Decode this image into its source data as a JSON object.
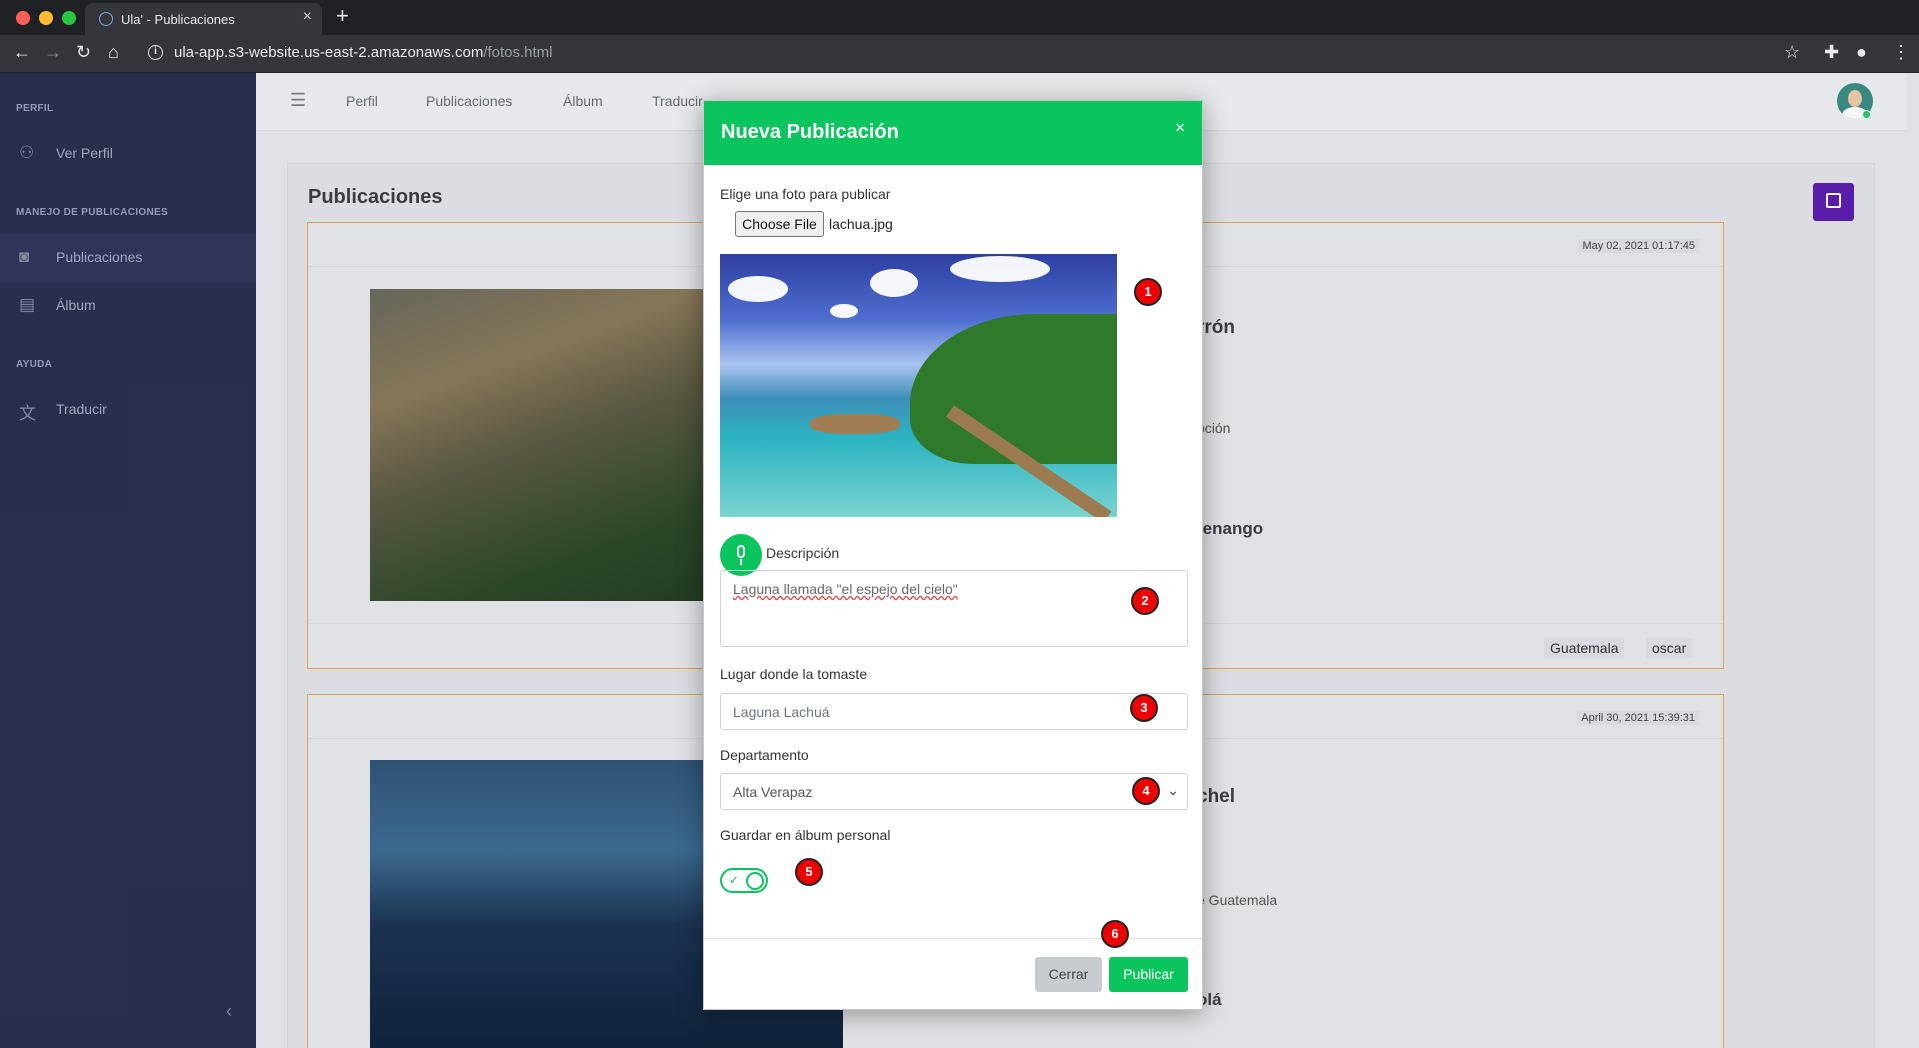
{
  "browser": {
    "tab_title": "Ula' - Publicaciones",
    "new_tab": "+",
    "tab_close": "×",
    "url_host": "ula-app.s3-website.us-east-2.amazonaws.com",
    "url_path": "/fotos.html",
    "traffic_colors": [
      "#ff5f57",
      "#febc2e",
      "#28c840"
    ]
  },
  "sidebar": {
    "sections": [
      "PERFIL",
      "MANEJO DE PUBLICACIONES",
      "AYUDA"
    ],
    "items": [
      {
        "label": "Ver Perfil",
        "icon": "user-icon"
      },
      {
        "label": "Publicaciones",
        "icon": "camera-icon"
      },
      {
        "label": "Álbum",
        "icon": "album-icon"
      },
      {
        "label": "Traducir",
        "icon": "translate-icon"
      }
    ],
    "collapse_glyph": "‹"
  },
  "topnav": {
    "links": [
      "Perfil",
      "Publicaciones",
      "Álbum",
      "Traducir"
    ]
  },
  "main": {
    "title": "Publicaciones",
    "posts": [
      {
        "date": "May 02, 2021 01:17:45",
        "title_fragment": "rrón",
        "text_fragment": "pción",
        "subtitle_fragment": "tenango",
        "tags": [
          "Guatemala",
          "oscar"
        ]
      },
      {
        "date": "April 30, 2021 15:39:31",
        "title_fragment": "chel",
        "text_fragment": "e Guatemala",
        "subtitle_fragment": "olá",
        "tags": []
      }
    ]
  },
  "modal": {
    "title": "Nueva Publicación",
    "close_glyph": "×",
    "file_label": "Elige una foto para publicar",
    "file_button": "Choose File",
    "file_name": "lachua.jpg",
    "description_label": "Descripción",
    "description_value": "Laguna llamada \"el espejo del cielo\"",
    "place_label": "Lugar donde la tomaste",
    "place_value": "Laguna Lachuá",
    "department_label": "Departamento",
    "department_value": "Alta Verapaz",
    "album_label": "Guardar en álbum personal",
    "album_toggle_on": true,
    "album_toggle_check": "✓",
    "close_button": "Cerrar",
    "publish_button": "Publicar"
  },
  "markers": [
    "1",
    "2",
    "3",
    "4",
    "5",
    "6"
  ],
  "colors": {
    "accent_green": "#0ac45d",
    "sidebar_bg": "#2c2f4f",
    "new_post_purple": "#5b1fb0",
    "marker_red": "#e00000"
  }
}
